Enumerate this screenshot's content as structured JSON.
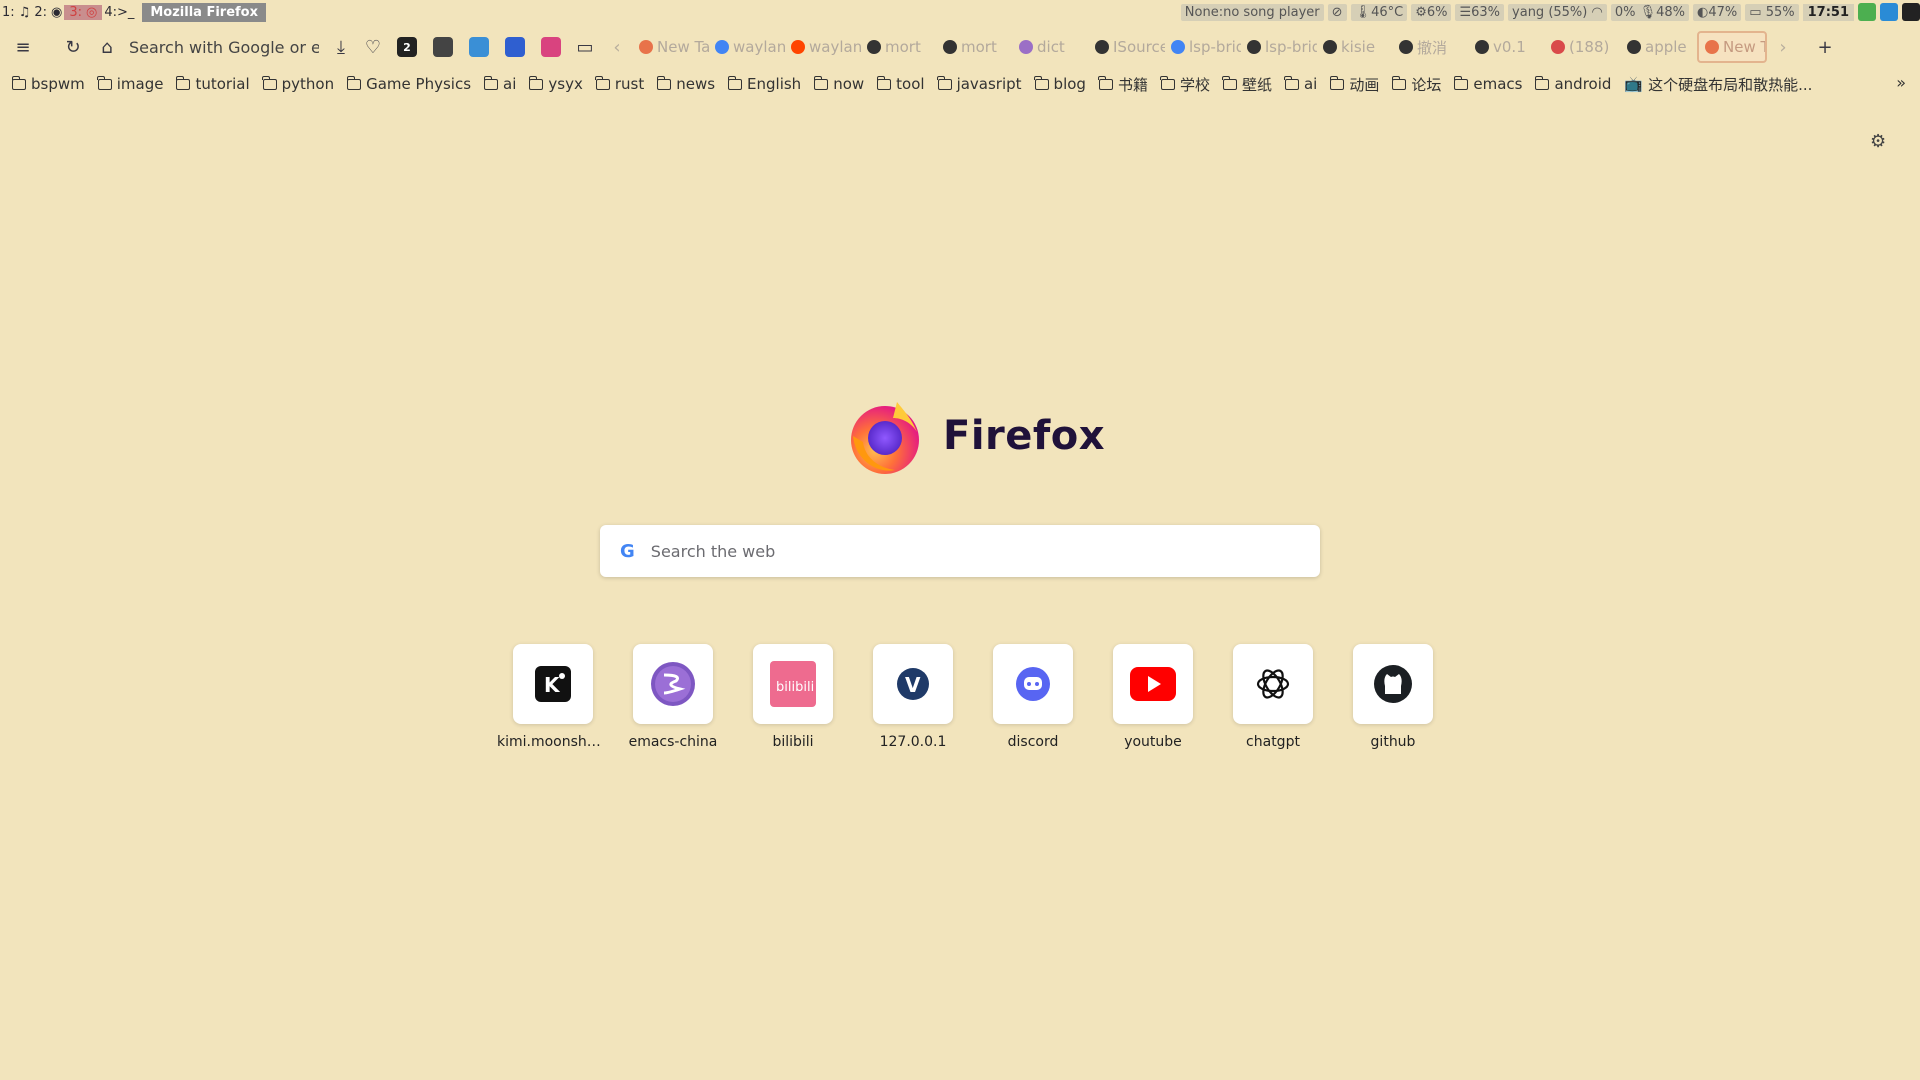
{
  "system_bar": {
    "workspaces": [
      "1:",
      "2:",
      "3:",
      "4:>_"
    ],
    "window_title": "Mozilla Firefox",
    "music": "None:no song player",
    "temperature": "46°C",
    "cpu": "6%",
    "memory": "63%",
    "wifi": "yang (55%)",
    "mic": "0%",
    "volume": "48%",
    "brightness": "47%",
    "battery": "55%",
    "clock": "17:51"
  },
  "toolbar": {
    "url_placeholder": "Search with Google or enter address",
    "extensions": [
      {
        "icon": "badge-2-icon",
        "text": "2",
        "color": "#222222"
      },
      {
        "icon": "bandit-icon",
        "text": "",
        "color": "#444444"
      },
      {
        "icon": "edge-icon",
        "text": "",
        "color": "#3a8fd6"
      },
      {
        "icon": "blue-square-icon",
        "text": "",
        "color": "#2f5fd0"
      },
      {
        "icon": "translate-icon",
        "text": "",
        "color": "#d9437f"
      }
    ]
  },
  "tabs": [
    {
      "label": "New Tab",
      "color": "#e8734a"
    },
    {
      "label": "wayland",
      "color": "#4285f4"
    },
    {
      "label": "wayland",
      "color": "#ff4500"
    },
    {
      "label": "mort",
      "color": "#333333"
    },
    {
      "label": "mort",
      "color": "#333333"
    },
    {
      "label": "dict",
      "color": "#9b6fc6"
    },
    {
      "label": "ISource",
      "color": "#333333"
    },
    {
      "label": "lsp-bridge",
      "color": "#4285f4"
    },
    {
      "label": "lsp-bridge",
      "color": "#333333"
    },
    {
      "label": "kisie",
      "color": "#333333"
    },
    {
      "label": "撤消",
      "color": "#333333"
    },
    {
      "label": "v0.1",
      "color": "#333333"
    },
    {
      "label": "(188)",
      "color": "#d94a4a"
    },
    {
      "label": "apple",
      "color": "#333333"
    },
    {
      "label": "New Tab",
      "color": "#e8734a"
    }
  ],
  "bookmarks": [
    "bspwm",
    "image",
    "tutorial",
    "python",
    "Game Physics",
    "ai",
    "ysyx",
    "rust",
    "news",
    "English",
    "now",
    "tool",
    "javasript",
    "blog",
    "书籍",
    "学校",
    "壁纸",
    "ai",
    "动画",
    "论坛",
    "emacs",
    "android"
  ],
  "bookmark_special": "这个硬盘布局和散热能...",
  "newtab": {
    "wordmark": "Firefox",
    "search_placeholder": "Search the web",
    "top_sites": [
      {
        "label": "kimi.moonshot.cn",
        "icon": "kimi-icon"
      },
      {
        "label": "emacs-china",
        "icon": "emacs-icon"
      },
      {
        "label": "bilibili",
        "icon": "bilibili-icon"
      },
      {
        "label": "127.0.0.1",
        "icon": "v-icon"
      },
      {
        "label": "discord",
        "icon": "discord-icon"
      },
      {
        "label": "youtube",
        "icon": "youtube-icon"
      },
      {
        "label": "chatgpt",
        "icon": "chatgpt-icon"
      },
      {
        "label": "github",
        "icon": "github-icon"
      }
    ]
  },
  "colors": {
    "background": "#f2e4bc",
    "brand_text": "#20123a",
    "active_tab_border": "#e3b48e"
  }
}
